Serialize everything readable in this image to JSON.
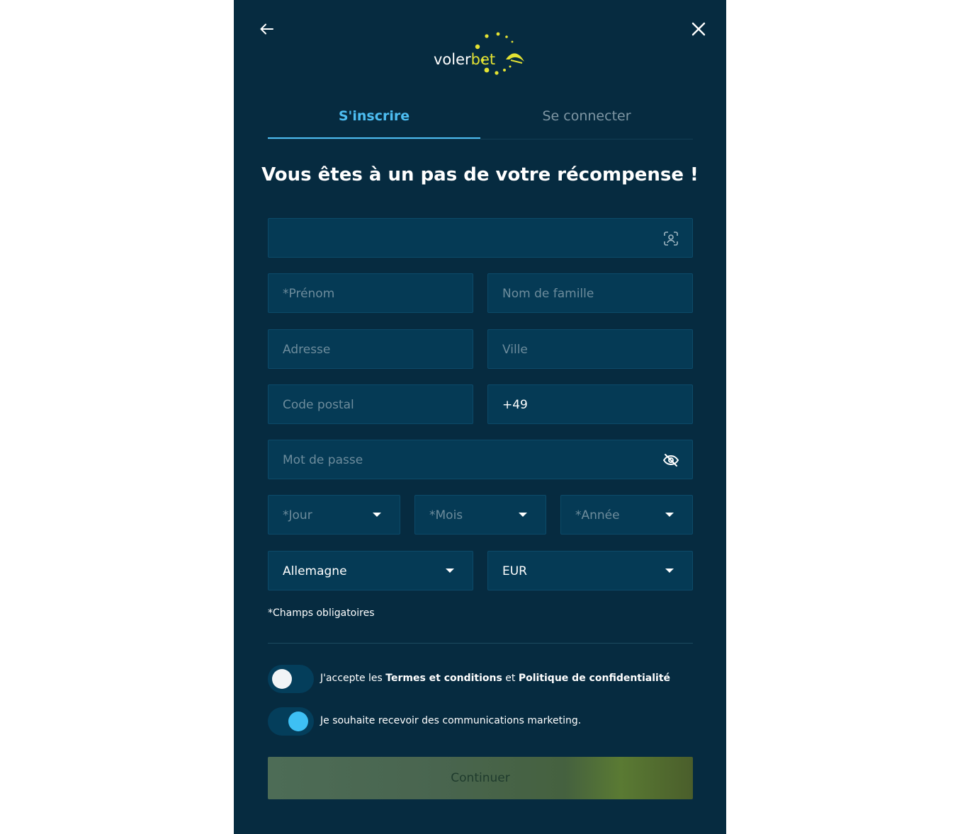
{
  "header": {
    "back_icon": "arrow-left-icon",
    "close_icon": "close-icon",
    "logo": {
      "part1": "voler",
      "part2": "bet"
    }
  },
  "tabs": [
    {
      "label": "S'inscrire",
      "active": true
    },
    {
      "label": "Se connecter",
      "active": false
    }
  ],
  "heading": "Vous êtes à un pas de votre récompense !",
  "form": {
    "email": {
      "value": "",
      "icon": "face-scan-icon"
    },
    "first_name": {
      "placeholder": "*Prénom"
    },
    "last_name": {
      "placeholder": "Nom de famille"
    },
    "address": {
      "placeholder": "Adresse"
    },
    "city": {
      "placeholder": "Ville"
    },
    "postal_code": {
      "placeholder": "Code postal"
    },
    "phone": {
      "value": "+49"
    },
    "password": {
      "placeholder": "Mot de passe",
      "icon": "eye-off-icon"
    },
    "day": {
      "placeholder": "*Jour"
    },
    "month": {
      "placeholder": "*Mois"
    },
    "year": {
      "placeholder": "*Année"
    },
    "country": {
      "value": "Allemagne"
    },
    "currency": {
      "value": "EUR"
    }
  },
  "required_note": "*Champs obligatoires",
  "consents": {
    "terms": {
      "prefix": "J'accepte les",
      "terms_link": "Termes et conditions",
      "and": "et",
      "privacy_link": "Politique de confidentialité",
      "checked": false
    },
    "marketing": {
      "label": "Je souhaite recevoir des communications marketing.",
      "checked": true
    }
  },
  "continue_label": "Continuer",
  "colors": {
    "background": "#062b40",
    "accent": "#4dbef2",
    "logo_yellow": "#e3e233",
    "field_bg": "#053a55"
  }
}
